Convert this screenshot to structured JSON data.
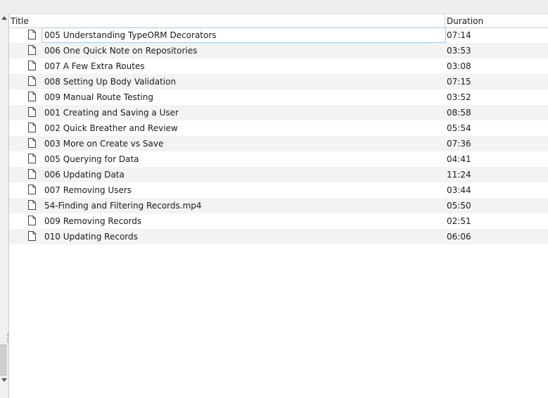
{
  "columns": {
    "title": "Title",
    "duration": "Duration"
  },
  "icons": {
    "file": "file-icon",
    "scroll_up": "arrow-up-icon",
    "scroll_down": "arrow-down-icon"
  },
  "rows": [
    {
      "title": "005 Understanding TypeORM Decorators",
      "duration": "07:14"
    },
    {
      "title": "006 One Quick Note on Repositories",
      "duration": "03:53"
    },
    {
      "title": "007 A Few Extra Routes",
      "duration": "03:08"
    },
    {
      "title": "008 Setting Up Body Validation",
      "duration": "07:15"
    },
    {
      "title": "009 Manual Route Testing",
      "duration": "03:52"
    },
    {
      "title": "001 Creating and Saving a User",
      "duration": "08:58"
    },
    {
      "title": "002 Quick Breather and Review",
      "duration": "05:54"
    },
    {
      "title": "003 More on Create vs Save",
      "duration": "07:36"
    },
    {
      "title": "005 Querying for Data",
      "duration": "04:41"
    },
    {
      "title": "006 Updating Data",
      "duration": "11:24"
    },
    {
      "title": "007 Removing Users",
      "duration": "03:44"
    },
    {
      "title": "54-Finding and Filtering Records.mp4",
      "duration": "05:50"
    },
    {
      "title": "009 Removing Records",
      "duration": "02:51"
    },
    {
      "title": "010 Updating Records",
      "duration": "06:06"
    }
  ]
}
